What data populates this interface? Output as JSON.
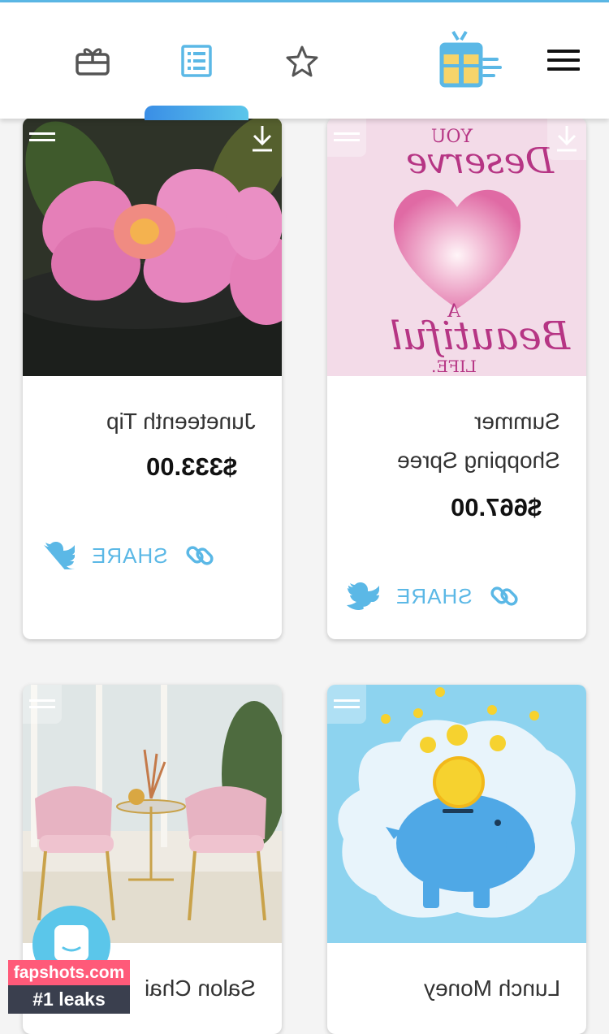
{
  "nav": {
    "tabs": [
      {
        "icon": "gift-box-icon",
        "active": false
      },
      {
        "icon": "list-document-icon",
        "active": true
      },
      {
        "icon": "star-icon",
        "active": false
      }
    ],
    "logo": "gift-logo",
    "menu_icon": "hamburger-menu-icon"
  },
  "colors": {
    "accent": "#5bb8e6",
    "tab_indicator_start": "#3a8ee6",
    "tab_indicator_end": "#5bc6ea"
  },
  "cards": [
    {
      "title": "Juneteenth Tip",
      "price": "$333.00",
      "share_label": "SHARE",
      "image": "pink-flower-photo"
    },
    {
      "title_line1": "Summer",
      "title_line2": "Shopping Spree",
      "price": "$667.00",
      "share_label": "SHARE",
      "image": "you-deserve-a-beautiful-life-heart",
      "image_text": [
        "YOU",
        "Deserve",
        "A",
        "Beautiful",
        "LIFE."
      ]
    },
    {
      "title": "Salon Chai",
      "image": "pink-salon-chairs-photo"
    },
    {
      "title": "Lunch Money",
      "image": "piggy-bank-coins-illustration"
    }
  ],
  "watermark": {
    "line1": "fapshots.com",
    "line2": "#1 leaks"
  }
}
